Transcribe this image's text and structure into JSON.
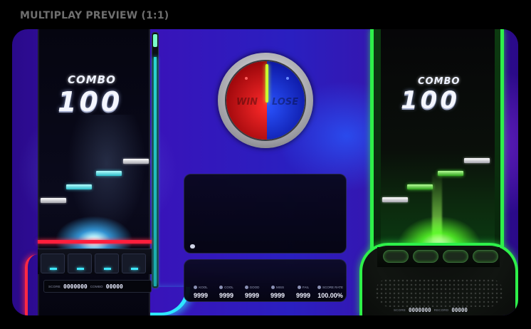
{
  "header": {
    "title": "MULTIPLAY PREVIEW (1:1)"
  },
  "player_left": {
    "combo_label": "COMBO",
    "combo_value": "100",
    "life_level": 0.9,
    "score_label": "SCORE",
    "score_value": "0000000",
    "combo_small_label": "COMBO",
    "combo_small_value": "00000",
    "theme_color": "#2ee6ff",
    "accent_color": "#ff2844"
  },
  "player_right": {
    "combo_label": "COMBO",
    "combo_value": "100",
    "score_label": "SCORE",
    "score_value": "0000000",
    "combo_small_label": "RECORD",
    "combo_small_value": "00000",
    "theme_color": "#2ef04a"
  },
  "gauge": {
    "win_label": "WIN",
    "lose_label": "LOSE",
    "win_color": "#ff2b2b",
    "lose_color": "#2a54ff",
    "needle_color": "#c8ff30"
  },
  "chat": {
    "icon": "chat-bubble-icon"
  },
  "stats": [
    {
      "label": "KOOL",
      "value": "9999",
      "icon": "kool-icon"
    },
    {
      "label": "COOL",
      "value": "9999",
      "icon": "cool-icon"
    },
    {
      "label": "GOOD",
      "value": "9999",
      "icon": "good-icon"
    },
    {
      "label": "MISS",
      "value": "9999",
      "icon": "miss-icon"
    },
    {
      "label": "FAIL",
      "value": "9999",
      "icon": "fail-icon"
    },
    {
      "label": "SCORE RATE",
      "value": "100.00%",
      "icon": "rate-icon"
    }
  ]
}
